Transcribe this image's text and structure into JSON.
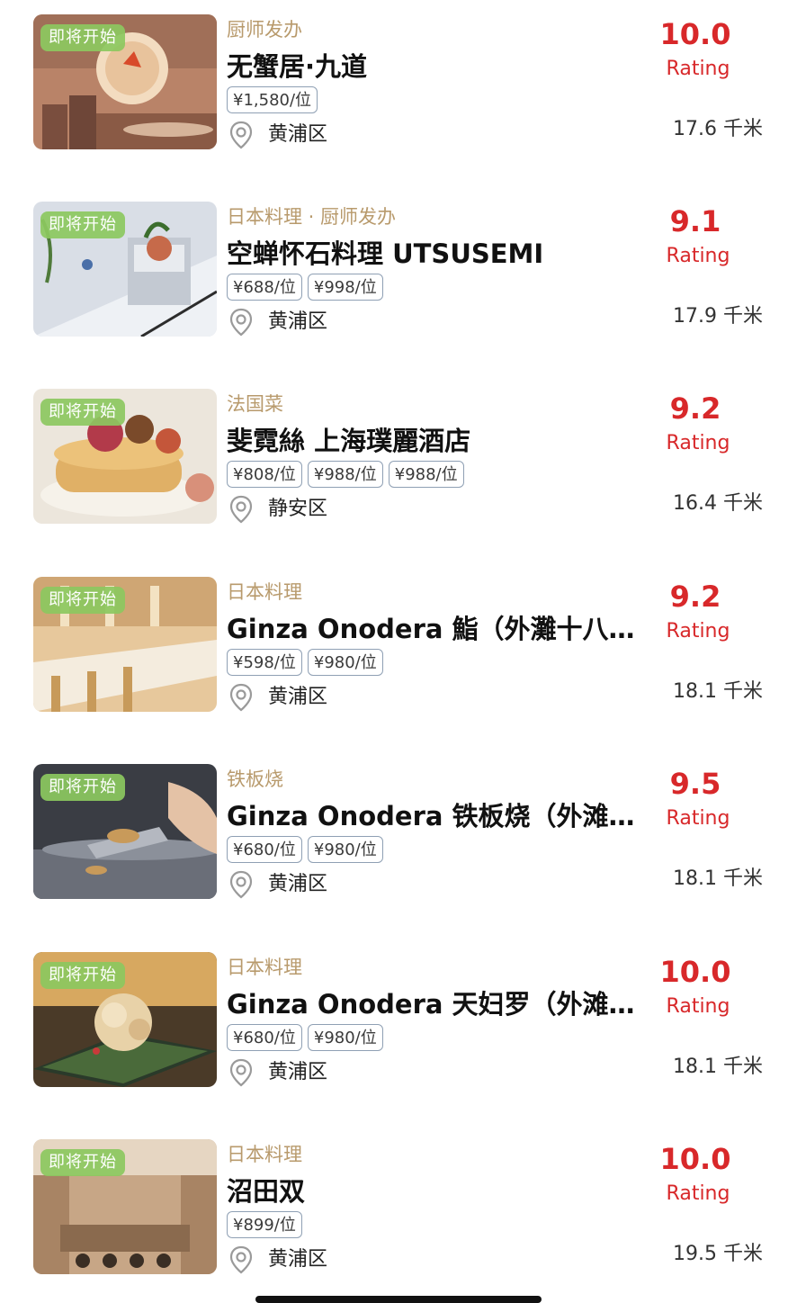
{
  "restaurants": [
    {
      "badge": "即将开始",
      "category": "厨师发办",
      "name": "无蟹居·九道",
      "prices": [
        "¥1,580/位"
      ],
      "district": "黄浦区",
      "score": "10.0",
      "rating_label": "Rating",
      "distance": "17.6 千米",
      "image": "dining-room"
    },
    {
      "badge": "即将开始",
      "category": "日本料理 · 厨师发办",
      "name": "空蝉怀石料理 UTSUSEMI",
      "prices": [
        "¥688/位",
        "¥998/位"
      ],
      "district": "黄浦区",
      "score": "9.1",
      "rating_label": "Rating",
      "distance": "17.9 千米",
      "image": "kaiseki-dish"
    },
    {
      "badge": "即将开始",
      "category": "法国菜",
      "name": "斐霓絲 上海璞麗酒店",
      "prices": [
        "¥808/位",
        "¥988/位",
        "¥988/位"
      ],
      "district": "静安区",
      "score": "9.2",
      "rating_label": "Rating",
      "distance": "16.4 千米",
      "image": "dessert-tart"
    },
    {
      "badge": "即将开始",
      "category": "日本料理",
      "name": "Ginza Onodera 鮨（外灘十八…",
      "prices": [
        "¥598/位",
        "¥980/位"
      ],
      "district": "黄浦区",
      "score": "9.2",
      "rating_label": "Rating",
      "distance": "18.1 千米",
      "image": "sushi-counter"
    },
    {
      "badge": "即将开始",
      "category": "铁板烧",
      "name": "Ginza Onodera 铁板烧（外滩…",
      "prices": [
        "¥680/位",
        "¥980/位"
      ],
      "district": "黄浦区",
      "score": "9.5",
      "rating_label": "Rating",
      "distance": "18.1 千米",
      "image": "teppanyaki"
    },
    {
      "badge": "即将开始",
      "category": "日本料理",
      "name": "Ginza Onodera 天妇罗（外滩…",
      "prices": [
        "¥680/位",
        "¥980/位"
      ],
      "district": "黄浦区",
      "score": "10.0",
      "rating_label": "Rating",
      "distance": "18.1 千米",
      "image": "tempura-plate"
    },
    {
      "badge": "即将开始",
      "category": "日本料理",
      "name": "沼田双",
      "prices": [
        "¥899/位"
      ],
      "district": "黄浦区",
      "score": "10.0",
      "rating_label": "Rating",
      "distance": "19.5 千米",
      "image": "restaurant-interior"
    }
  ],
  "colors": {
    "score": "#d8282a",
    "category": "#b89a6c",
    "badge": "#8cc860",
    "price_border": "#8fa0b4"
  }
}
